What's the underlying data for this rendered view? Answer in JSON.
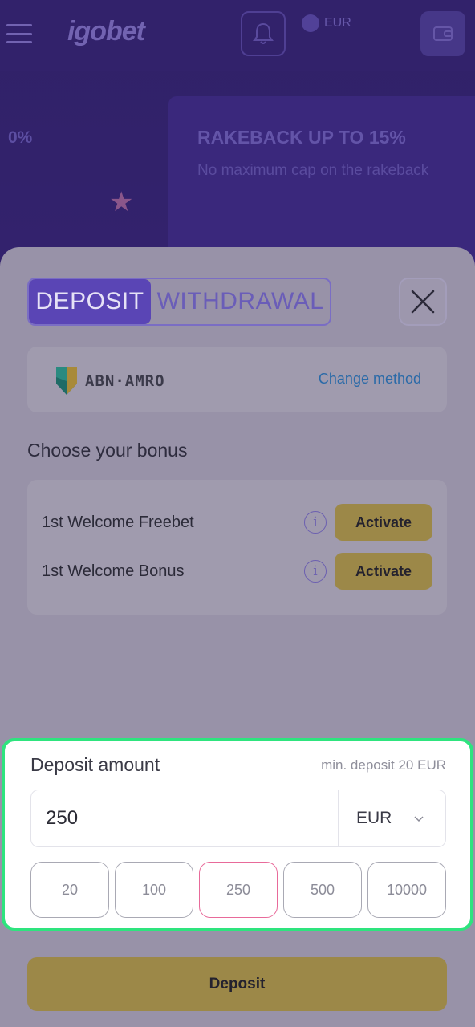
{
  "header": {
    "logo_text": "igobet",
    "balance_text": "EUR"
  },
  "banner": {
    "left_text": "0%",
    "title": "RAKEBACK UP TO 15%",
    "subtitle": "No maximum cap on the rakeback"
  },
  "modal": {
    "tabs": [
      {
        "label": "DEPOSIT",
        "active": true
      },
      {
        "label": "WITHDRAWAL",
        "active": false
      }
    ],
    "method": {
      "bank_name": "ABN·AMRO",
      "change_label": "Change method"
    },
    "bonus": {
      "heading": "Choose your bonus",
      "items": [
        {
          "name": "1st Welcome Freebet",
          "action": "Activate"
        },
        {
          "name": "1st Welcome Bonus",
          "action": "Activate"
        }
      ]
    },
    "amount": {
      "title": "Deposit amount",
      "min_label": "min. deposit 20 EUR",
      "value": "250",
      "currency": "EUR",
      "presets": [
        "20",
        "100",
        "250",
        "500",
        "10000"
      ],
      "selected_preset": "250"
    },
    "deposit_button": "Deposit"
  },
  "colors": {
    "accent": "#5a45b5",
    "highlight": "#2ee47e",
    "activate": "#9c8848",
    "selected_preset_border": "#e86a9a"
  }
}
